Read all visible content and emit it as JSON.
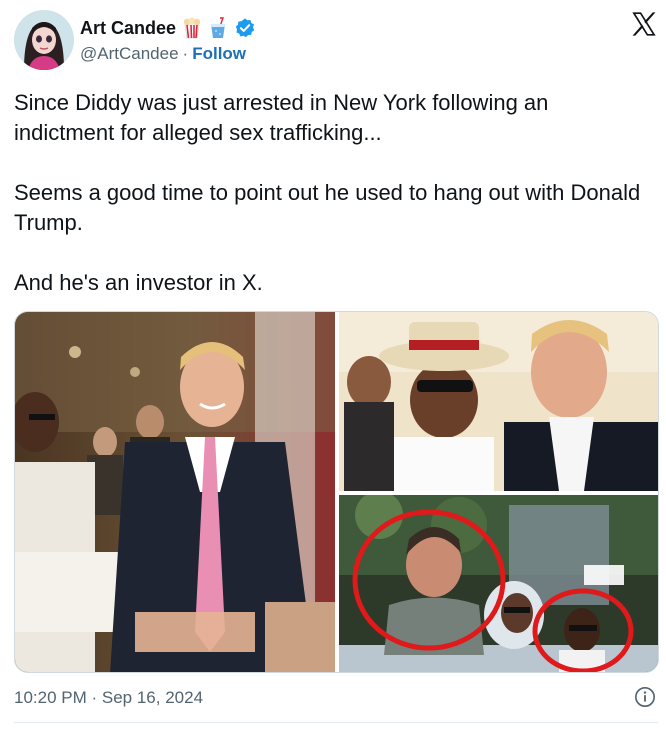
{
  "author": {
    "name": "Art Candee",
    "handle": "@ArtCandee",
    "separator": "·",
    "follow_label": "Follow",
    "name_emojis": [
      "popcorn-icon",
      "drink-cup-icon"
    ],
    "verified_icon": "verified-badge-icon",
    "avatar": "avatar"
  },
  "brand_icon": "x-logo-icon",
  "tweet": {
    "text": "Since Diddy was just arrested in New York following an indictment for alleged sex trafficking...\n\nSeems a good time to point out he used to hang out with Donald Trump.\n\nAnd he's an investor in X."
  },
  "media": {
    "images": [
      {
        "name": "photo-trump-diddy-event"
      },
      {
        "name": "photo-diddy-trump-hat"
      },
      {
        "name": "photo-musk-diddy-circled"
      }
    ]
  },
  "footer": {
    "timestamp": "10:20 PM · Sep 16, 2024",
    "info_icon": "info-icon"
  },
  "colors": {
    "text": "#0f1419",
    "secondary": "#536471",
    "link": "#1d70b8",
    "verified": "#1d9bf0",
    "circle": "#e0191b"
  }
}
